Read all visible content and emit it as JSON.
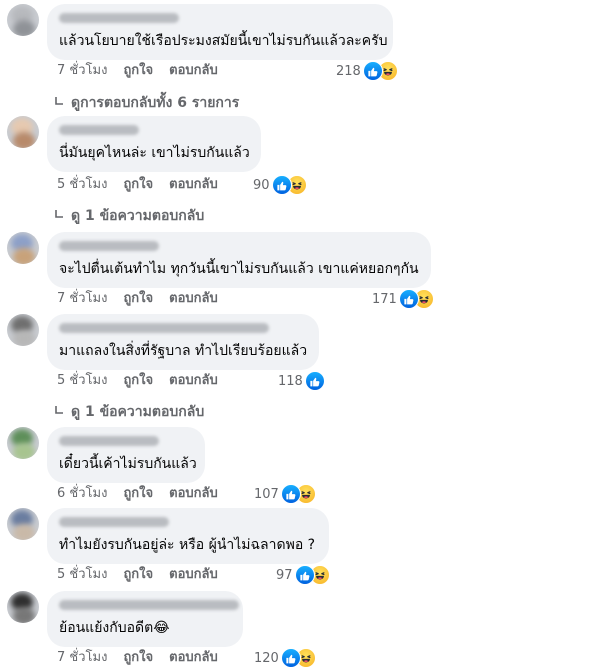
{
  "comments": [
    {
      "text": "แล้วนโยบายใช้เรือประมงสมัยนี้เขาไม่รบกันแล้วละครับ",
      "time": "7 ชั่วโมง",
      "like": "ถูกใจ",
      "reply": "ตอบกลับ",
      "count": "218",
      "reactions": [
        "like",
        "haha"
      ],
      "replies": "ดูการตอบกลับทั้ง 6 รายการ"
    },
    {
      "text": "นี่มันยุคไหนล่ะ เขาไม่รบกันแล้ว",
      "time": "5 ชั่วโมง",
      "like": "ถูกใจ",
      "reply": "ตอบกลับ",
      "count": "90",
      "reactions": [
        "like",
        "haha"
      ],
      "replies": "ดู 1 ข้อความตอบกลับ"
    },
    {
      "text": "จะไปตื่นเต้นทำไม ทุกวันนี้เขาไม่รบกันแล้ว เขาแค่หยอกๆกัน",
      "time": "7 ชั่วโมง",
      "like": "ถูกใจ",
      "reply": "ตอบกลับ",
      "count": "171",
      "reactions": [
        "like",
        "haha"
      ]
    },
    {
      "text": "มาแถลงในสิ่งที่รัฐบาล ทำไปเรียบร้อยแล้ว",
      "time": "5 ชั่วโมง",
      "like": "ถูกใจ",
      "reply": "ตอบกลับ",
      "count": "118",
      "reactions": [
        "like"
      ],
      "replies": "ดู 1 ข้อความตอบกลับ"
    },
    {
      "text": "เดี๋ยวนี้เค้าไม่รบกันแล้ว",
      "time": "6 ชั่วโมง",
      "like": "ถูกใจ",
      "reply": "ตอบกลับ",
      "count": "107",
      "reactions": [
        "like",
        "haha"
      ]
    },
    {
      "text": "ทำไมยังรบกันอยู่ล่ะ หรือ ผู้นำไม่ฉลาดพอ ?",
      "time": "5 ชั่วโมง",
      "like": "ถูกใจ",
      "reply": "ตอบกลับ",
      "count": "97",
      "reactions": [
        "like",
        "haha"
      ]
    },
    {
      "text": "ย้อนแย้งกับอดีต😂",
      "time": "7 ชั่วโมง",
      "like": "ถูกใจ",
      "reply": "ตอบกลับ",
      "count": "120",
      "reactions": [
        "like",
        "haha"
      ]
    }
  ],
  "colors": {
    "like": "#1877f2",
    "haha": "#f7b125",
    "bubble": "#f0f2f5",
    "meta": "#65676b"
  }
}
